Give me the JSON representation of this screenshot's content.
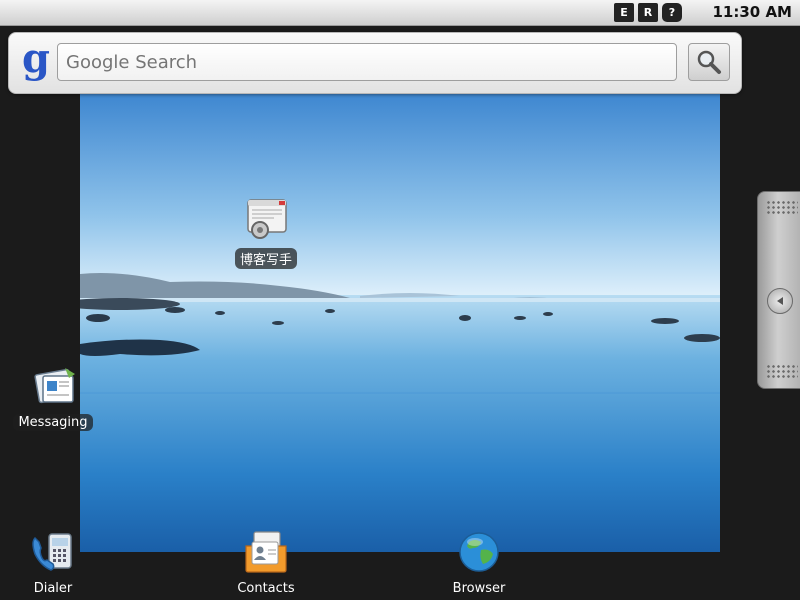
{
  "status_bar": {
    "icons": [
      "E",
      "R",
      "?"
    ],
    "time": "11:30 AM"
  },
  "search": {
    "placeholder": "Google Search",
    "logo_letter": "g"
  },
  "desktop": {
    "shortcut": {
      "label": "博客写手",
      "icon": "window-gear-icon"
    },
    "messaging": {
      "label": "Messaging",
      "icon": "messaging-icon"
    }
  },
  "dock": {
    "dialer": {
      "label": "Dialer",
      "icon": "phone-icon"
    },
    "contacts": {
      "label": "Contacts",
      "icon": "contacts-icon"
    },
    "browser": {
      "label": "Browser",
      "icon": "globe-icon"
    }
  },
  "colors": {
    "accent": "#2a56c6",
    "background": "#1b1b1b"
  }
}
